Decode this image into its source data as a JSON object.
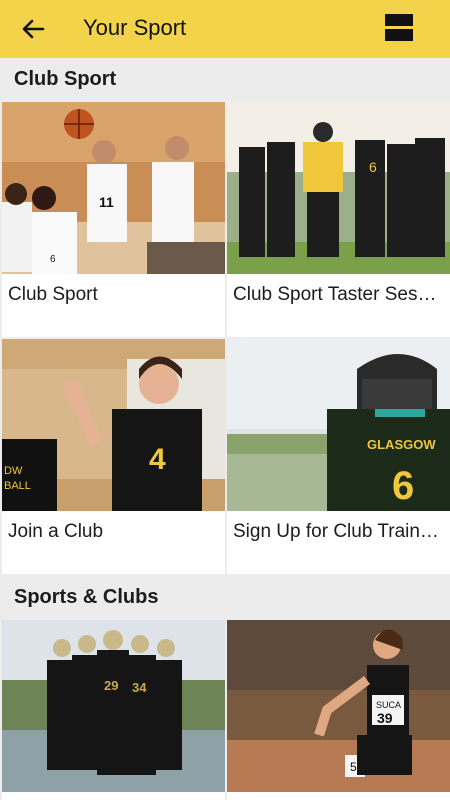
{
  "header": {
    "title": "Your Sport",
    "back_icon": "arrow-left-icon",
    "menu_icon": "view-toggle-icon",
    "background": "#f3d34a"
  },
  "sections": [
    {
      "title": "Club Sport",
      "cards": [
        {
          "label": "Club Sport",
          "image": "basketball-team-photo"
        },
        {
          "label": "Club Sport Taster Sessions",
          "image": "hockey-team-huddle-photo"
        },
        {
          "label": "Join a Club",
          "image": "netball-high-five-photo"
        },
        {
          "label": "Sign Up for Club Training",
          "image": "hockey-player-helmet-photo"
        }
      ]
    },
    {
      "title": "Sports & Clubs",
      "cards": [
        {
          "label": "",
          "image": "american-football-team-photo"
        },
        {
          "label": "",
          "image": "athletics-runner-photo"
        }
      ]
    }
  ]
}
